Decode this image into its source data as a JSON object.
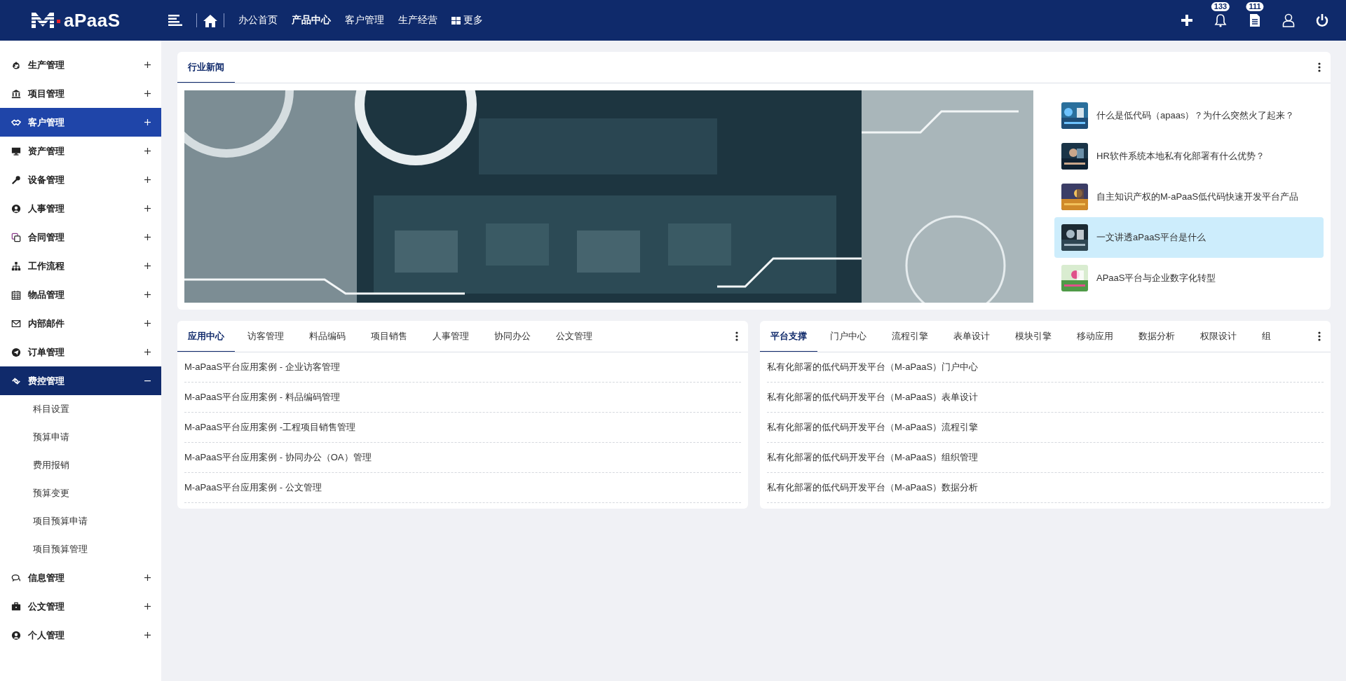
{
  "header": {
    "brand": "aPaaS",
    "nav": [
      {
        "label": "办公首页",
        "selected": false
      },
      {
        "label": "产品中心",
        "selected": true
      },
      {
        "label": "客户管理",
        "selected": false
      },
      {
        "label": "生产经营",
        "selected": false
      }
    ],
    "more": "更多",
    "badges": {
      "notifications": "133",
      "messages": "111"
    }
  },
  "sidebar": {
    "items": [
      {
        "label": "生产管理",
        "selected": false,
        "expanded": false
      },
      {
        "label": "项目管理",
        "selected": false,
        "expanded": false
      },
      {
        "label": "客户管理",
        "selected": true,
        "expanded": false
      },
      {
        "label": "资产管理",
        "selected": false,
        "expanded": false
      },
      {
        "label": "设备管理",
        "selected": false,
        "expanded": false
      },
      {
        "label": "人事管理",
        "selected": false,
        "expanded": false
      },
      {
        "label": "合同管理",
        "selected": false,
        "expanded": false
      },
      {
        "label": "工作流程",
        "selected": false,
        "expanded": false
      },
      {
        "label": "物品管理",
        "selected": false,
        "expanded": false
      },
      {
        "label": "内部邮件",
        "selected": false,
        "expanded": false
      },
      {
        "label": "订单管理",
        "selected": false,
        "expanded": false
      },
      {
        "label": "费控管理",
        "selected": false,
        "expanded": true,
        "children": [
          {
            "label": "科目设置"
          },
          {
            "label": "预算申请"
          },
          {
            "label": "费用报销"
          },
          {
            "label": "预算变更"
          },
          {
            "label": "项目预算申请"
          },
          {
            "label": "项目预算管理"
          }
        ]
      },
      {
        "label": "信息管理",
        "selected": false,
        "expanded": false
      },
      {
        "label": "公文管理",
        "selected": false,
        "expanded": false
      },
      {
        "label": "个人管理",
        "selected": false,
        "expanded": false
      }
    ]
  },
  "news": {
    "tab": "行业新闻",
    "items": [
      {
        "title": "什么是低代码（apaas）？为什么突然火了起来？",
        "selected": false
      },
      {
        "title": "HR软件系统本地私有化部署有什么优势？",
        "selected": false
      },
      {
        "title": "自主知识产权的M-aPaaS低代码快速开发平台产品",
        "selected": false
      },
      {
        "title": "一文讲透aPaaS平台是什么",
        "selected": true
      },
      {
        "title": "APaaS平台与企业数字化转型",
        "selected": false
      }
    ]
  },
  "panels": [
    {
      "tabs": [
        {
          "label": "应用中心",
          "selected": true
        },
        {
          "label": "访客管理",
          "selected": false
        },
        {
          "label": "料品编码",
          "selected": false
        },
        {
          "label": "项目销售",
          "selected": false
        },
        {
          "label": "人事管理",
          "selected": false
        },
        {
          "label": "协同办公",
          "selected": false
        },
        {
          "label": "公文管理",
          "selected": false
        }
      ],
      "rows": [
        "M-aPaaS平台应用案例 - 企业访客管理",
        "M-aPaaS平台应用案例 - 料品编码管理",
        "M-aPaaS平台应用案例 -工程项目销售管理",
        "M-aPaaS平台应用案例 - 协同办公（OA）管理",
        "M-aPaaS平台应用案例 - 公文管理"
      ]
    },
    {
      "tabs": [
        {
          "label": "平台支撑",
          "selected": true
        },
        {
          "label": "门户中心",
          "selected": false
        },
        {
          "label": "流程引擎",
          "selected": false
        },
        {
          "label": "表单设计",
          "selected": false
        },
        {
          "label": "模块引擎",
          "selected": false
        },
        {
          "label": "移动应用",
          "selected": false
        },
        {
          "label": "数据分析",
          "selected": false
        },
        {
          "label": "权限设计",
          "selected": false
        },
        {
          "label": "组",
          "selected": false
        }
      ],
      "rows": [
        "私有化部署的低代码开发平台（M-aPaaS）门户中心",
        "私有化部署的低代码开发平台（M-aPaaS）表单设计",
        "私有化部署的低代码开发平台（M-aPaaS）流程引擎",
        "私有化部署的低代码开发平台（M-aPaaS）组织管理",
        "私有化部署的低代码开发平台（M-aPaaS）数据分析"
      ]
    }
  ]
}
